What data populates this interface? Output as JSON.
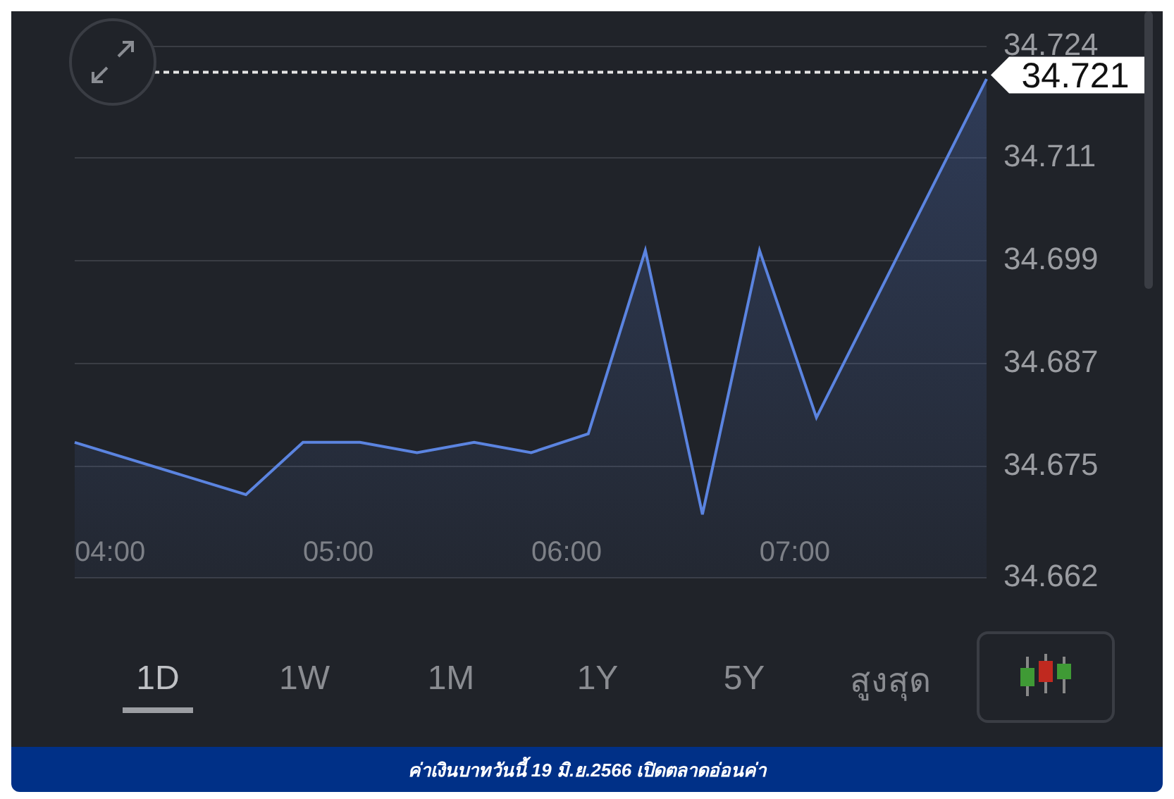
{
  "chart": {
    "chart_data": {
      "type": "area",
      "grid": true,
      "x": [
        3.845,
        4.595,
        4.845,
        5.095,
        5.345,
        5.595,
        5.845,
        6.095,
        6.345,
        6.595,
        6.845,
        7.095,
        7.84
      ],
      "series": [
        {
          "color": "#5b84e0",
          "values": [
            34.6778,
            34.6717,
            34.6778,
            34.6778,
            34.6766,
            34.6778,
            34.6766,
            34.6788,
            34.7002,
            34.6694,
            34.7002,
            34.6807,
            34.7202
          ]
        }
      ],
      "xlim": [
        3.845,
        7.84
      ],
      "ylim": [
        34.662,
        34.724
      ],
      "xticks": [
        {
          "value": 4,
          "label": "04:00"
        },
        {
          "value": 5,
          "label": "05:00"
        },
        {
          "value": 6,
          "label": "06:00"
        },
        {
          "value": 7,
          "label": "07:00"
        }
      ],
      "yticks": [
        {
          "value": 34.662,
          "label": "34.662"
        },
        {
          "value": 34.675,
          "label": "34.675"
        },
        {
          "value": 34.687,
          "label": "34.687"
        },
        {
          "value": 34.699,
          "label": "34.699"
        },
        {
          "value": 34.711,
          "label": "34.711"
        },
        {
          "value": 34.724,
          "label": "34.724"
        }
      ],
      "ref_lines": [
        {
          "axis": "y",
          "value": 34.721,
          "label": "34.721"
        }
      ]
    }
  },
  "ranges": [
    {
      "label": "1D",
      "selected": true
    },
    {
      "label": "1W",
      "selected": false
    },
    {
      "label": "1M",
      "selected": false
    },
    {
      "label": "1Y",
      "selected": false
    },
    {
      "label": "5Y",
      "selected": false
    },
    {
      "label": "สูงสุด",
      "selected": false
    }
  ],
  "banner": "ค่าเงินบาทวันนี้ 19 มิ.ย.2566 เปิดตลาดอ่อนค่า"
}
